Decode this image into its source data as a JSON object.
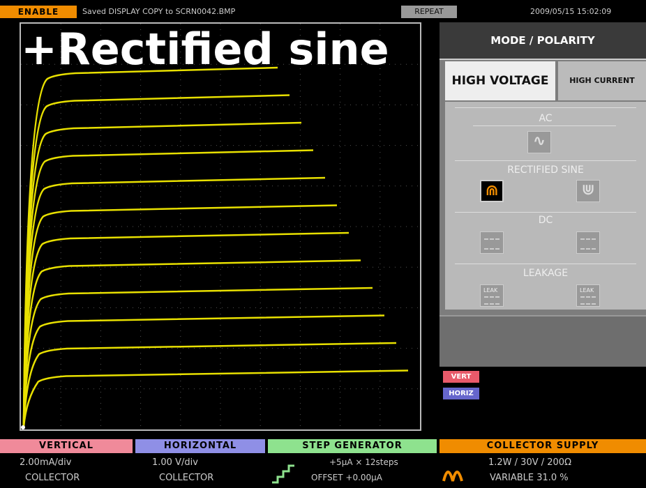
{
  "status": {
    "enable_label": "ENABLE",
    "message": "Saved DISPLAY COPY to SCRN0042.BMP",
    "mode_label": "REPEAT",
    "datetime": "2009/05/15 15:02:09"
  },
  "title": "+Rectified sine",
  "panel": {
    "header": "MODE / POLARITY",
    "tab_high_voltage": "HIGH VOLTAGE",
    "tab_high_current": "HIGH CURRENT",
    "section_ac": "AC",
    "section_rectified": "RECTIFIED  SINE",
    "section_dc": "DC",
    "section_leakage": "LEAKAGE",
    "leak_text": "LEAK"
  },
  "chips": {
    "vert": "VERT",
    "horiz": "HORIZ"
  },
  "bottom": {
    "vertical": {
      "head": "VERTICAL",
      "line1": "2.00mA/div",
      "line2": "COLLECTOR"
    },
    "horizontal": {
      "head": "HORIZONTAL",
      "line1": "1.00  V/div",
      "line2": "COLLECTOR"
    },
    "step": {
      "head": "STEP  GENERATOR",
      "line1": "+5μA  ×  12steps",
      "line2": "OFFSET    +0.00μA"
    },
    "collector": {
      "head": "COLLECTOR  SUPPLY",
      "line1": "1.2W  /  30V  /    200Ω",
      "line2": "VARIABLE         31.0 %"
    }
  },
  "colors": {
    "trace": "#e8e000",
    "accent": "#f08c00"
  },
  "icons": [
    "ac-sine-icon",
    "rectified-positive-icon",
    "rectified-negative-icon",
    "dc-positive-icon",
    "dc-negative-icon",
    "leakage-positive-icon",
    "leakage-negative-icon",
    "step-generator-icon",
    "collector-rectified-icon"
  ]
}
